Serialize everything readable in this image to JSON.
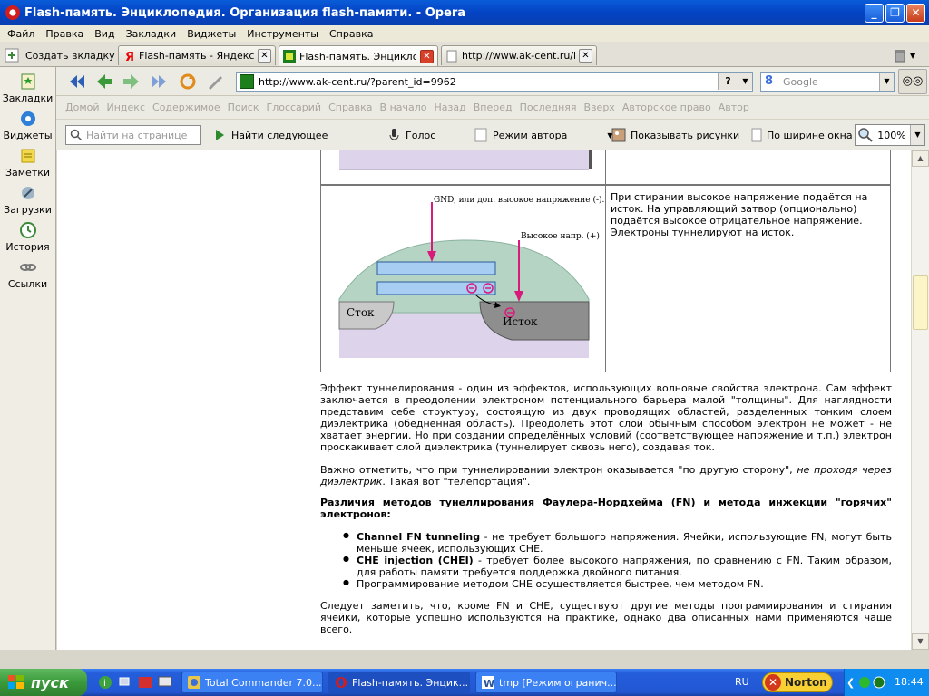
{
  "window": {
    "title": "Flash-память. Энциклопедия. Организация flash-памяти. - Opera"
  },
  "menu": [
    "Файл",
    "Правка",
    "Вид",
    "Закладки",
    "Виджеты",
    "Инструменты",
    "Справка"
  ],
  "tabs": {
    "new_tab": "Создать вкладку",
    "items": [
      {
        "label": "Flash-память - Яндекс: ...",
        "icon": "yandex-icon",
        "active": false
      },
      {
        "label": "Flash-память. Энцикло...",
        "icon": "site-icon",
        "active": true
      },
      {
        "label": "http://www.ak-cent.ru/i...",
        "icon": "page-icon",
        "active": false
      }
    ]
  },
  "sidebar": {
    "items": [
      {
        "label": "Закладки",
        "icon": "bookmarks-icon"
      },
      {
        "label": "Виджеты",
        "icon": "widgets-icon"
      },
      {
        "label": "Заметки",
        "icon": "notes-icon"
      },
      {
        "label": "Загрузки",
        "icon": "downloads-icon"
      },
      {
        "label": "История",
        "icon": "history-icon"
      },
      {
        "label": "Ссылки",
        "icon": "links-icon"
      }
    ]
  },
  "address": {
    "url": "http://www.ak-cent.ru/?parent_id=9962",
    "help": "?",
    "search_placeholder": "Google",
    "search_engine": "8"
  },
  "linkbar": [
    "Домой",
    "Индекс",
    "Содержимое",
    "Поиск",
    "Глоссарий",
    "Справка",
    "В начало",
    "Назад",
    "Вперед",
    "Последняя",
    "Вверх",
    "Авторское право",
    "Автор"
  ],
  "pagebar": {
    "find_placeholder": "Найти на странице",
    "find_next": "Найти следующее",
    "voice": "Голос",
    "author_mode": "Режим автора",
    "show_images": "Показывать рисунки",
    "fit_width": "По ширине окна",
    "zoom": "100%"
  },
  "diagram": {
    "label_top": "GND, или доп. высокое напряжение (-).",
    "label_right": "Высокое напр. (+)",
    "label_drain": "Сток",
    "label_source": "Исток",
    "caption": "При стирании высокое напряжение подаётся на исток. На управляющий затвор (опционально) подаётся высокое отрицательное напряжение. Электроны туннелируют на исток."
  },
  "article": {
    "p1": "Эффект туннелирования - один из эффектов, использующих волновые свойства электрона. Сам эффект заключается в преодолении электроном потенциального барьера малой \"толщины\". Для наглядности представим себе структуру, состоящую из двух проводящих областей, разделенных тонким слоем диэлектрика (обеднённая область). Преодолеть этот слой обычным способом электрон не может - не хватает энергии. Но при создании определённых условий (соответствующее напряжение и т.п.) электрон проскакивает слой диэлектрика (туннелирует сквозь него), создавая ток.",
    "p2_start": "Важно отметить, что при туннелировании электрон оказывается \"по другую сторону\", ",
    "p2_italic": "не проходя через диэлектрик",
    "p2_end": ". Такая вот \"телепортация\".",
    "heading": "Различия методов тунеллирования Фаулера-Нордхейма (FN) и метода инжекции \"горячих\" электронов:",
    "list": [
      {
        "bold": "Channel FN tunneling",
        "text": " - не требует большого напряжения. Ячейки, использующие FN, могут быть меньше ячеек, использующих CHE."
      },
      {
        "bold": "CHE injection (CHEI)",
        "text": " - требует более высокого напряжения, по сравнению с FN. Таким образом, для работы памяти требуется поддержка двойного питания."
      },
      {
        "bold": "",
        "text": "Программирование методом CHE осуществляется быстрее, чем методом FN."
      }
    ],
    "p3": "Следует заметить, что, кроме FN и CHE, существуют другие методы программирования и стирания ячейки, которые успешно используются на практике, однако два описанных нами применяются чаще всего."
  },
  "taskbar": {
    "start": "пуск",
    "tasks": [
      {
        "label": "Total Commander 7.0...",
        "icon": "total-commander-icon"
      },
      {
        "label": "Flash-память. Энцик...",
        "icon": "opera-icon"
      },
      {
        "label": "tmp [Режим огранич...",
        "icon": "word-icon"
      }
    ],
    "lang": "RU",
    "norton": "Norton",
    "clock": "18:44"
  }
}
